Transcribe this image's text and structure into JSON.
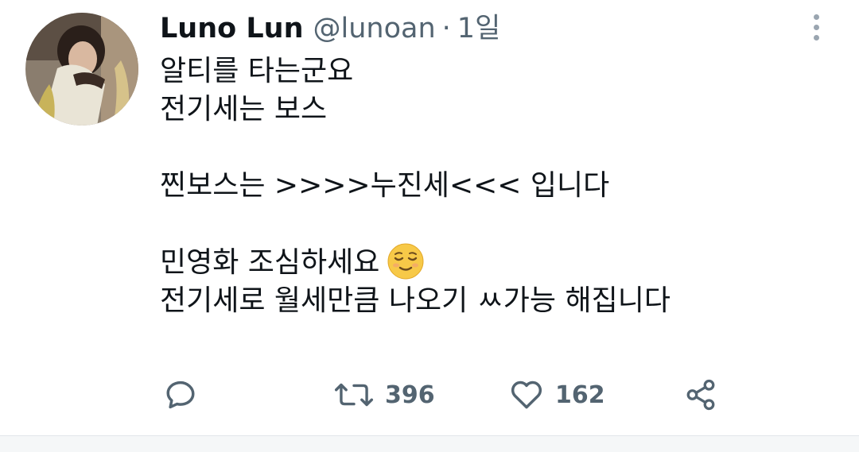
{
  "tweet": {
    "display_name": "Luno Lun",
    "handle": "@lunoan",
    "separator": "·",
    "time": "1일",
    "lines": {
      "l1": "알티를 타는군요",
      "l2": "전기세는 보스",
      "l3": "찐보스는 >>>>누진세<<< 입니다",
      "l4": "민영화 조심하세요",
      "l5": "전기세로 월세만큼 나오기 ㅆ가능 해집니다"
    },
    "emoji": "relieved-face",
    "retweet_count": "396",
    "like_count": "162"
  },
  "icons": {
    "avatar": "avatar-image",
    "more": "more-vertical-icon",
    "reply": "reply-icon",
    "retweet": "retweet-icon",
    "like": "heart-icon",
    "share": "share-icon"
  },
  "colors": {
    "text": "#0f1419",
    "secondary": "#536471",
    "background": "#ffffff"
  }
}
